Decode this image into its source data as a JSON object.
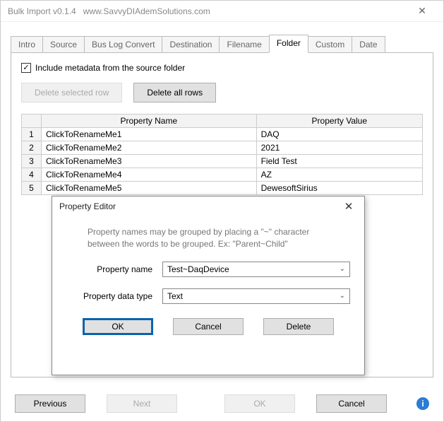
{
  "window": {
    "title": "Bulk Import v0.1.4",
    "url": "www.SavvyDIAdemSolutions.com"
  },
  "tabs": {
    "items": [
      "Intro",
      "Source",
      "Bus Log Convert",
      "Destination",
      "Filename",
      "Folder",
      "Custom",
      "Date"
    ],
    "active": "Folder"
  },
  "folder": {
    "checkbox_label": "Include metadata from the source folder",
    "checked": true,
    "delete_selected_label": "Delete selected row",
    "delete_all_label": "Delete all rows",
    "columns": {
      "name": "Property Name",
      "value": "Property Value"
    },
    "rows": [
      {
        "num": "1",
        "name": "ClickToRenameMe1",
        "value": "DAQ"
      },
      {
        "num": "2",
        "name": "ClickToRenameMe2",
        "value": "2021"
      },
      {
        "num": "3",
        "name": "ClickToRenameMe3",
        "value": "Field Test"
      },
      {
        "num": "4",
        "name": "ClickToRenameMe4",
        "value": "AZ"
      },
      {
        "num": "5",
        "name": "ClickToRenameMe5",
        "value": "DewesoftSirius"
      }
    ]
  },
  "dialog": {
    "title": "Property Editor",
    "hint_line1": "Property names may be grouped by placing a \"~\" character",
    "hint_line2": "between the words to be grouped.  Ex:  \"Parent~Child\"",
    "name_label": "Property name",
    "name_value": "Test~DaqDevice",
    "type_label": "Property data type",
    "type_value": "Text",
    "ok_label": "OK",
    "cancel_label": "Cancel",
    "delete_label": "Delete"
  },
  "bottom": {
    "previous": "Previous",
    "next": "Next",
    "ok": "OK",
    "cancel": "Cancel"
  },
  "icons": {
    "check": "✓",
    "close": "✕",
    "dropdown": "⌄",
    "info": "i"
  }
}
